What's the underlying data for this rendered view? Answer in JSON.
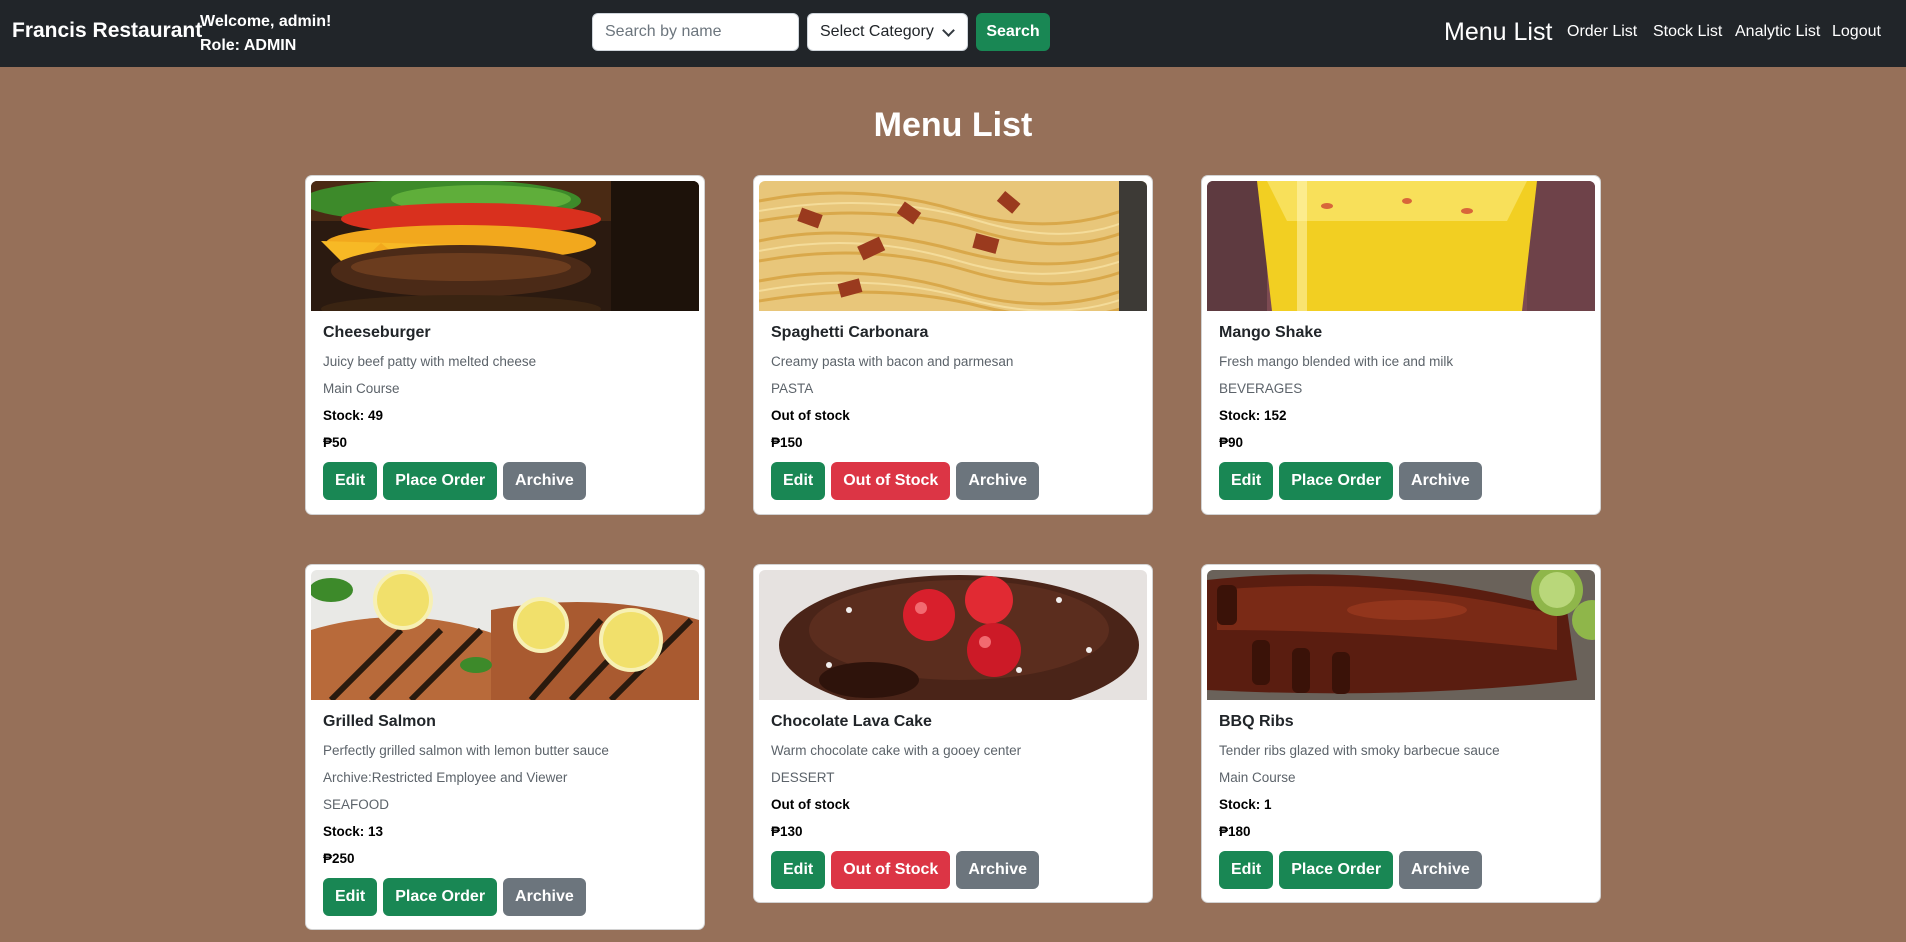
{
  "navbar": {
    "brand": "Francis Restaurant",
    "welcome": "Welcome, admin!",
    "role": "Role: ADMIN",
    "search_placeholder": "Search by name",
    "category_selected": "Select Category",
    "search_label": "Search",
    "title": "Menu List",
    "links": [
      "Order List",
      "Stock List",
      "Analytic List",
      "Logout"
    ]
  },
  "page": {
    "title": "Menu List"
  },
  "colors": {
    "navbar": "#212529",
    "background": "#967059",
    "success": "#198754",
    "danger": "#dc3545",
    "secondary": "#6c757d"
  },
  "cards": [
    {
      "name": "Cheeseburger",
      "description": "Juicy beef patty with melted cheese",
      "restriction": "",
      "category": "Main Course",
      "stock": "Stock: 49",
      "price": "₱50",
      "edit": "Edit",
      "action": "Place Order",
      "archive": "Archive",
      "image": "cheeseburger-photo"
    },
    {
      "name": "Spaghetti Carbonara",
      "description": "Creamy pasta with bacon and parmesan",
      "restriction": "",
      "category": "PASTA",
      "stock": "Out of stock",
      "price": "₱150",
      "edit": "Edit",
      "action": "Out of Stock",
      "archive": "Archive",
      "image": "spaghetti-photo"
    },
    {
      "name": "Mango Shake",
      "description": "Fresh mango blended with ice and milk",
      "restriction": "",
      "category": "BEVERAGES",
      "stock": "Stock: 152",
      "price": "₱90",
      "edit": "Edit",
      "action": "Place Order",
      "archive": "Archive",
      "image": "mango-shake-photo"
    },
    {
      "name": "Grilled Salmon",
      "description": "Perfectly grilled salmon with lemon butter sauce",
      "restriction": "Archive:Restricted Employee and Viewer",
      "category": "SEAFOOD",
      "stock": "Stock: 13",
      "price": "₱250",
      "edit": "Edit",
      "action": "Place Order",
      "archive": "Archive",
      "image": "grilled-salmon-photo"
    },
    {
      "name": "Chocolate Lava Cake",
      "description": "Warm chocolate cake with a gooey center",
      "restriction": "",
      "category": "DESSERT",
      "stock": "Out of stock",
      "price": "₱130",
      "edit": "Edit",
      "action": "Out of Stock",
      "archive": "Archive",
      "image": "lava-cake-photo"
    },
    {
      "name": "BBQ Ribs",
      "description": "Tender ribs glazed with smoky barbecue sauce",
      "restriction": "",
      "category": "Main Course",
      "stock": "Stock: 1",
      "price": "₱180",
      "edit": "Edit",
      "action": "Place Order",
      "archive": "Archive",
      "image": "bbq-ribs-photo"
    }
  ]
}
